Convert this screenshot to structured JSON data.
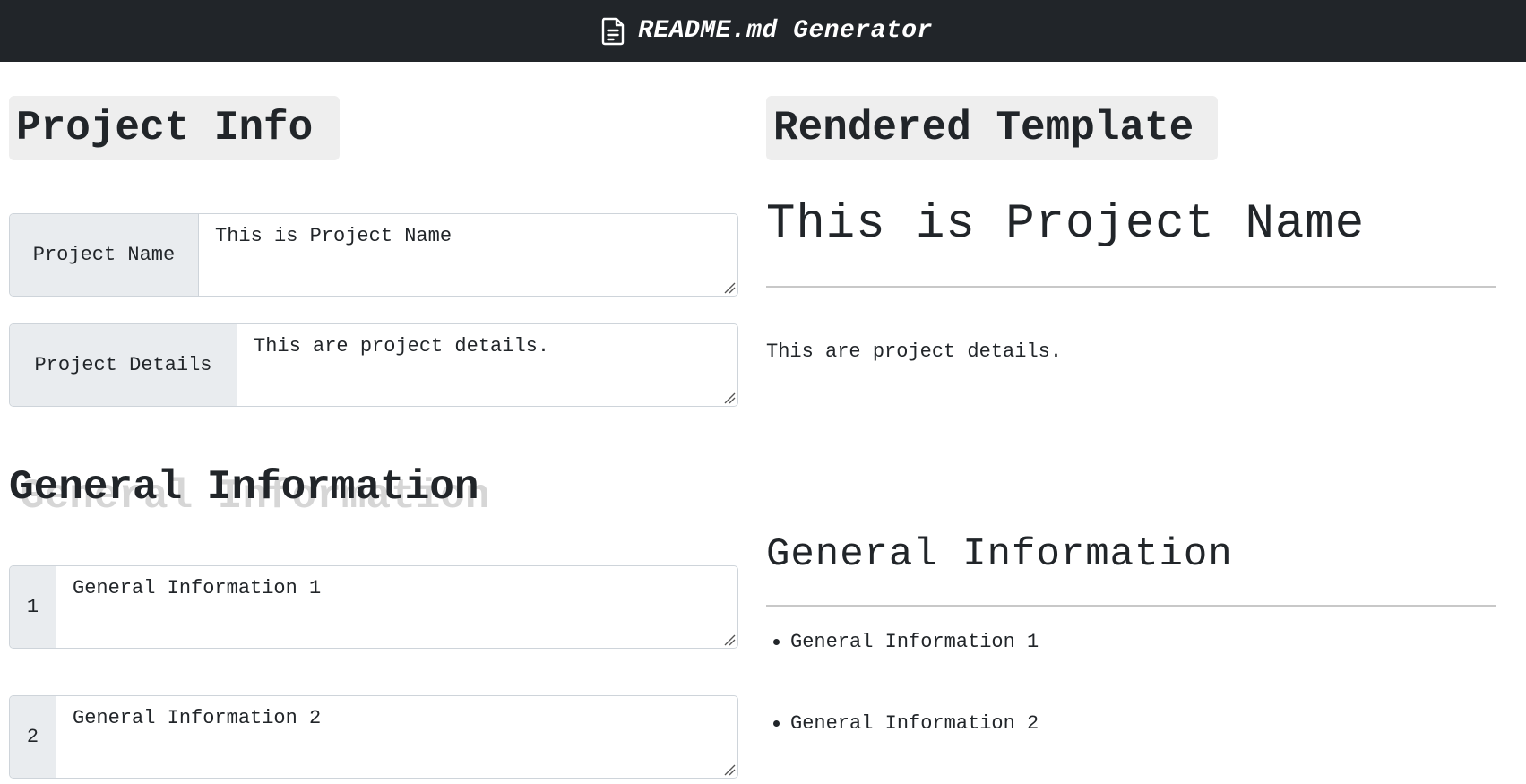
{
  "app": {
    "title": "README.md Generator",
    "icon": "document-icon"
  },
  "left": {
    "project_info_heading": "Project Info",
    "fields": {
      "project_name": {
        "label": "Project Name",
        "value": "This is Project Name"
      },
      "project_details": {
        "label": "Project Details",
        "value": "This are project details."
      }
    },
    "general_heading": "General Information",
    "general_items": [
      {
        "number": "1",
        "value": "General Information 1"
      },
      {
        "number": "2",
        "value": "General Information 2"
      }
    ]
  },
  "right": {
    "rendered_heading": "Rendered Template",
    "title": "This is Project Name",
    "details": "This are project details.",
    "general_heading": "General Information",
    "bullets": [
      "General Information 1",
      "General Information 2"
    ]
  },
  "colors": {
    "navbar": "#212529",
    "heading_bg": "#eeeeee",
    "input_group_bg": "#e9ecef",
    "border": "#ced4da"
  }
}
